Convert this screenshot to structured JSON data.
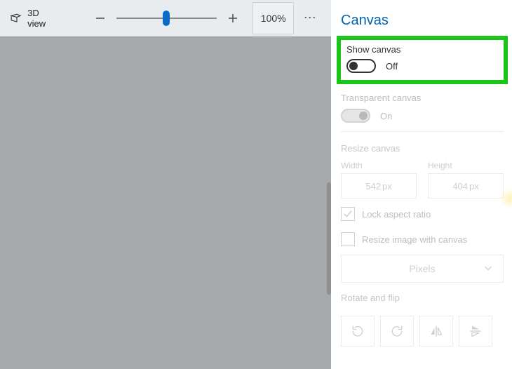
{
  "topbar": {
    "view3d_label": "3D view",
    "zoom_pct": "100%"
  },
  "panel": {
    "title": "Canvas",
    "show_canvas": {
      "label": "Show canvas",
      "state": "Off"
    },
    "transparent_canvas": {
      "label": "Transparent canvas",
      "state": "On"
    },
    "resize": {
      "label": "Resize canvas",
      "width_label": "Width",
      "height_label": "Height",
      "width_value": "542",
      "height_value": "404",
      "unit_suffix": "px",
      "lock_label": "Lock aspect ratio",
      "resize_img_label": "Resize image with canvas",
      "unit_select": "Pixels"
    },
    "rotate_label": "Rotate and flip"
  }
}
